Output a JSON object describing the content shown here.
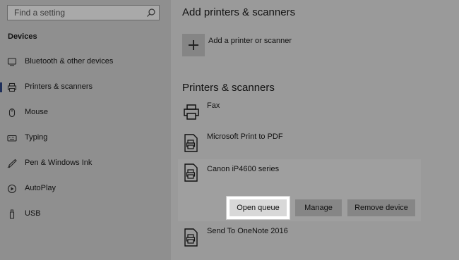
{
  "search": {
    "placeholder": "Find a setting",
    "icon": "search-icon"
  },
  "sidebar": {
    "section_title": "Devices",
    "items": [
      {
        "label": "Bluetooth & other devices",
        "icon": "bluetooth-icon",
        "active": false
      },
      {
        "label": "Printers & scanners",
        "icon": "printer-icon",
        "active": true
      },
      {
        "label": "Mouse",
        "icon": "mouse-icon",
        "active": false
      },
      {
        "label": "Typing",
        "icon": "keyboard-icon",
        "active": false
      },
      {
        "label": "Pen & Windows Ink",
        "icon": "pen-icon",
        "active": false
      },
      {
        "label": "AutoPlay",
        "icon": "autoplay-icon",
        "active": false
      },
      {
        "label": "USB",
        "icon": "usb-icon",
        "active": false
      }
    ]
  },
  "main": {
    "add_heading": "Add printers & scanners",
    "add_button_label": "Add a printer or scanner",
    "printers_heading": "Printers & scanners",
    "devices": [
      {
        "name": "Fax",
        "icon": "fax-icon"
      },
      {
        "name": "Microsoft Print to PDF",
        "icon": "document-printer-icon"
      },
      {
        "name": "Canon iP4600 series",
        "icon": "document-printer-icon"
      },
      {
        "name": "Send To OneNote 2016",
        "icon": "document-printer-icon"
      }
    ],
    "actions": {
      "open_queue": "Open queue",
      "manage": "Manage",
      "remove_device": "Remove device"
    }
  },
  "colors": {
    "highlight_outline": "#ffffff",
    "active_indicator": "#1f2f5a"
  }
}
